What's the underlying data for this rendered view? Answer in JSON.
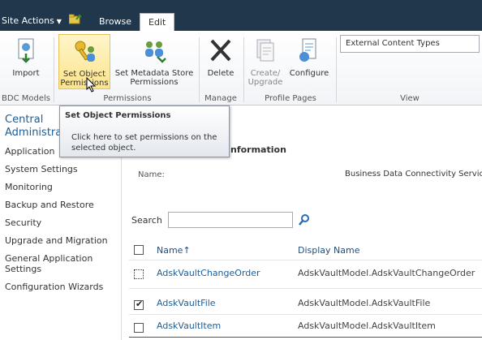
{
  "topbar": {
    "site_actions": "Site Actions",
    "tabs": [
      {
        "label": "Browse",
        "active": false
      },
      {
        "label": "Edit",
        "active": true
      }
    ]
  },
  "ribbon": {
    "buttons": {
      "import": "Import",
      "set_object_permissions": [
        "Set Object",
        "Permissions"
      ],
      "set_metadata_store_permissions": [
        "Set Metadata Store",
        "Permissions"
      ],
      "delete": "Delete",
      "create_upgrade": [
        "Create/",
        "Upgrade"
      ],
      "configure": "Configure"
    },
    "groups": {
      "bdc_models": "BDC Models",
      "permissions": "Permissions",
      "manage": "Manage",
      "profile_pages": "Profile Pages",
      "view": "View"
    },
    "view_selected": "External Content Types"
  },
  "tooltip": {
    "title": "Set Object Permissions",
    "body": "Click here to set permissions on the selected object."
  },
  "leftnav": {
    "heading_line1": "Central",
    "heading_line2": "Administra",
    "items": [
      "Application",
      "System Settings",
      "Monitoring",
      "Backup and Restore",
      "Security",
      "Upgrade and Migration",
      "General Application Settings",
      "Configuration Wizards"
    ]
  },
  "main": {
    "section_title": "nformation",
    "name_label": "Name:",
    "name_value": "Business Data Connectivity Service",
    "search_label": "Search",
    "search_value": "",
    "columns": {
      "name": "Name",
      "display_name": "Display Name"
    },
    "rows": [
      {
        "name": "AdskVaultChangeOrder",
        "display": "AdskVaultModel.AdskVaultChangeOrder",
        "checked": false
      },
      {
        "name": "AdskVaultFile",
        "display": "AdskVaultModel.AdskVaultFile",
        "checked": true
      },
      {
        "name": "AdskVaultItem",
        "display": "AdskVaultModel.AdskVaultItem",
        "checked": false
      }
    ]
  },
  "colors": {
    "topbar": "#21374c",
    "link": "#1f5d96",
    "hover_button": "#fce48e"
  }
}
